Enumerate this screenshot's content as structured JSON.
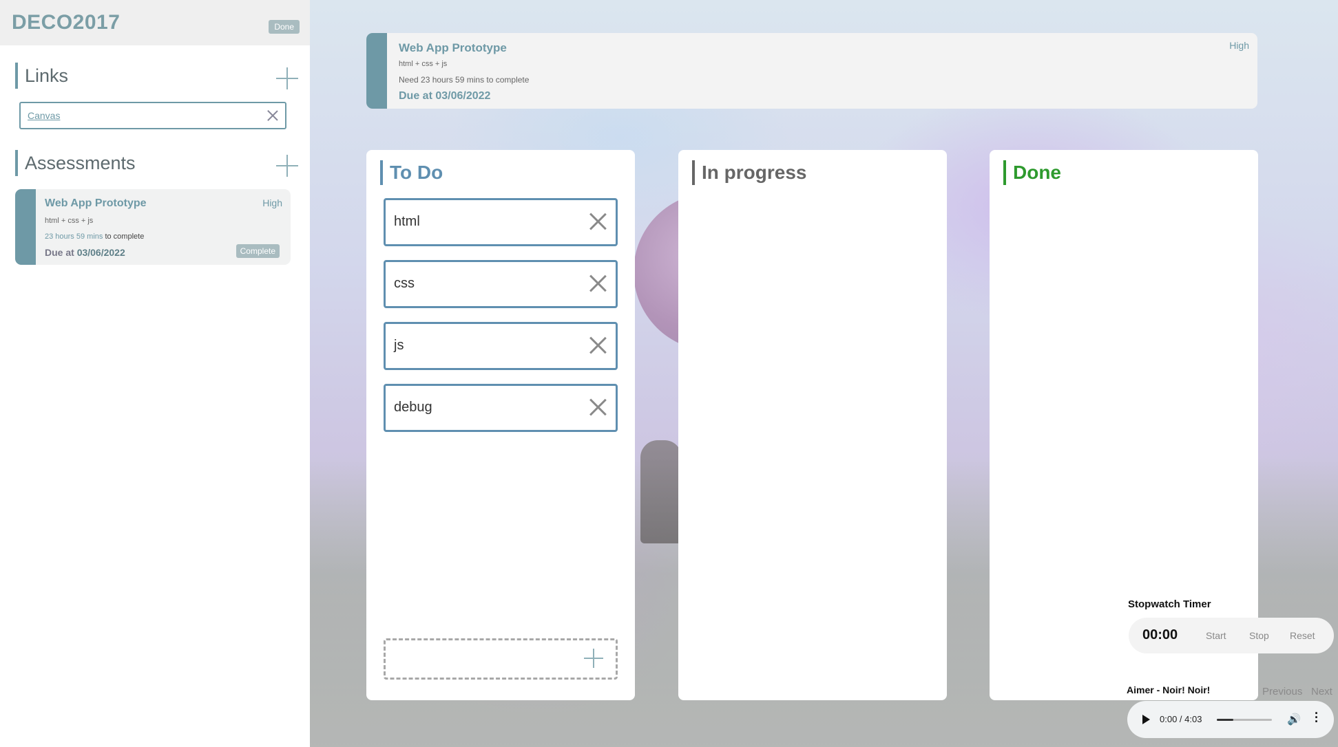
{
  "sidebar": {
    "title": "DECO2017",
    "done_label": "Done",
    "links_heading": "Links",
    "link_value": "Canvas",
    "assessments_heading": "Assessments",
    "assessment": {
      "title": "Web App Prototype",
      "priority": "High",
      "description": "html + css + js",
      "time_left": "23 hours 59 mins",
      "time_suffix": "to complete",
      "due_prefix": "Due at",
      "due_date": "03/06/2022",
      "complete_label": "Complete"
    }
  },
  "header_card": {
    "title": "Web App Prototype",
    "priority": "High",
    "description": "html + css + js",
    "time_text": "Need 23 hours 59 mins to complete",
    "due_text": "Due at 03/06/2022"
  },
  "board": {
    "todo": {
      "heading": "To Do",
      "color": "#5f8fb0",
      "tasks": [
        "html",
        "css",
        "js",
        "debug"
      ]
    },
    "in_progress": {
      "heading": "In progress",
      "color": "#666666"
    },
    "done": {
      "heading": "Done",
      "color": "#2e9a2e"
    }
  },
  "stopwatch": {
    "title": "Stopwatch Timer",
    "time": "00:00",
    "start_label": "Start",
    "stop_label": "Stop",
    "reset_label": "Reset"
  },
  "music": {
    "track": "Aimer - Noir! Noir!",
    "previous_label": "Previous",
    "next_label": "Next",
    "time": "0:00 / 4:03",
    "volume_fraction": 0.3
  },
  "colors": {
    "accent": "#6e99a6",
    "task_border": "#5f8fb0"
  }
}
